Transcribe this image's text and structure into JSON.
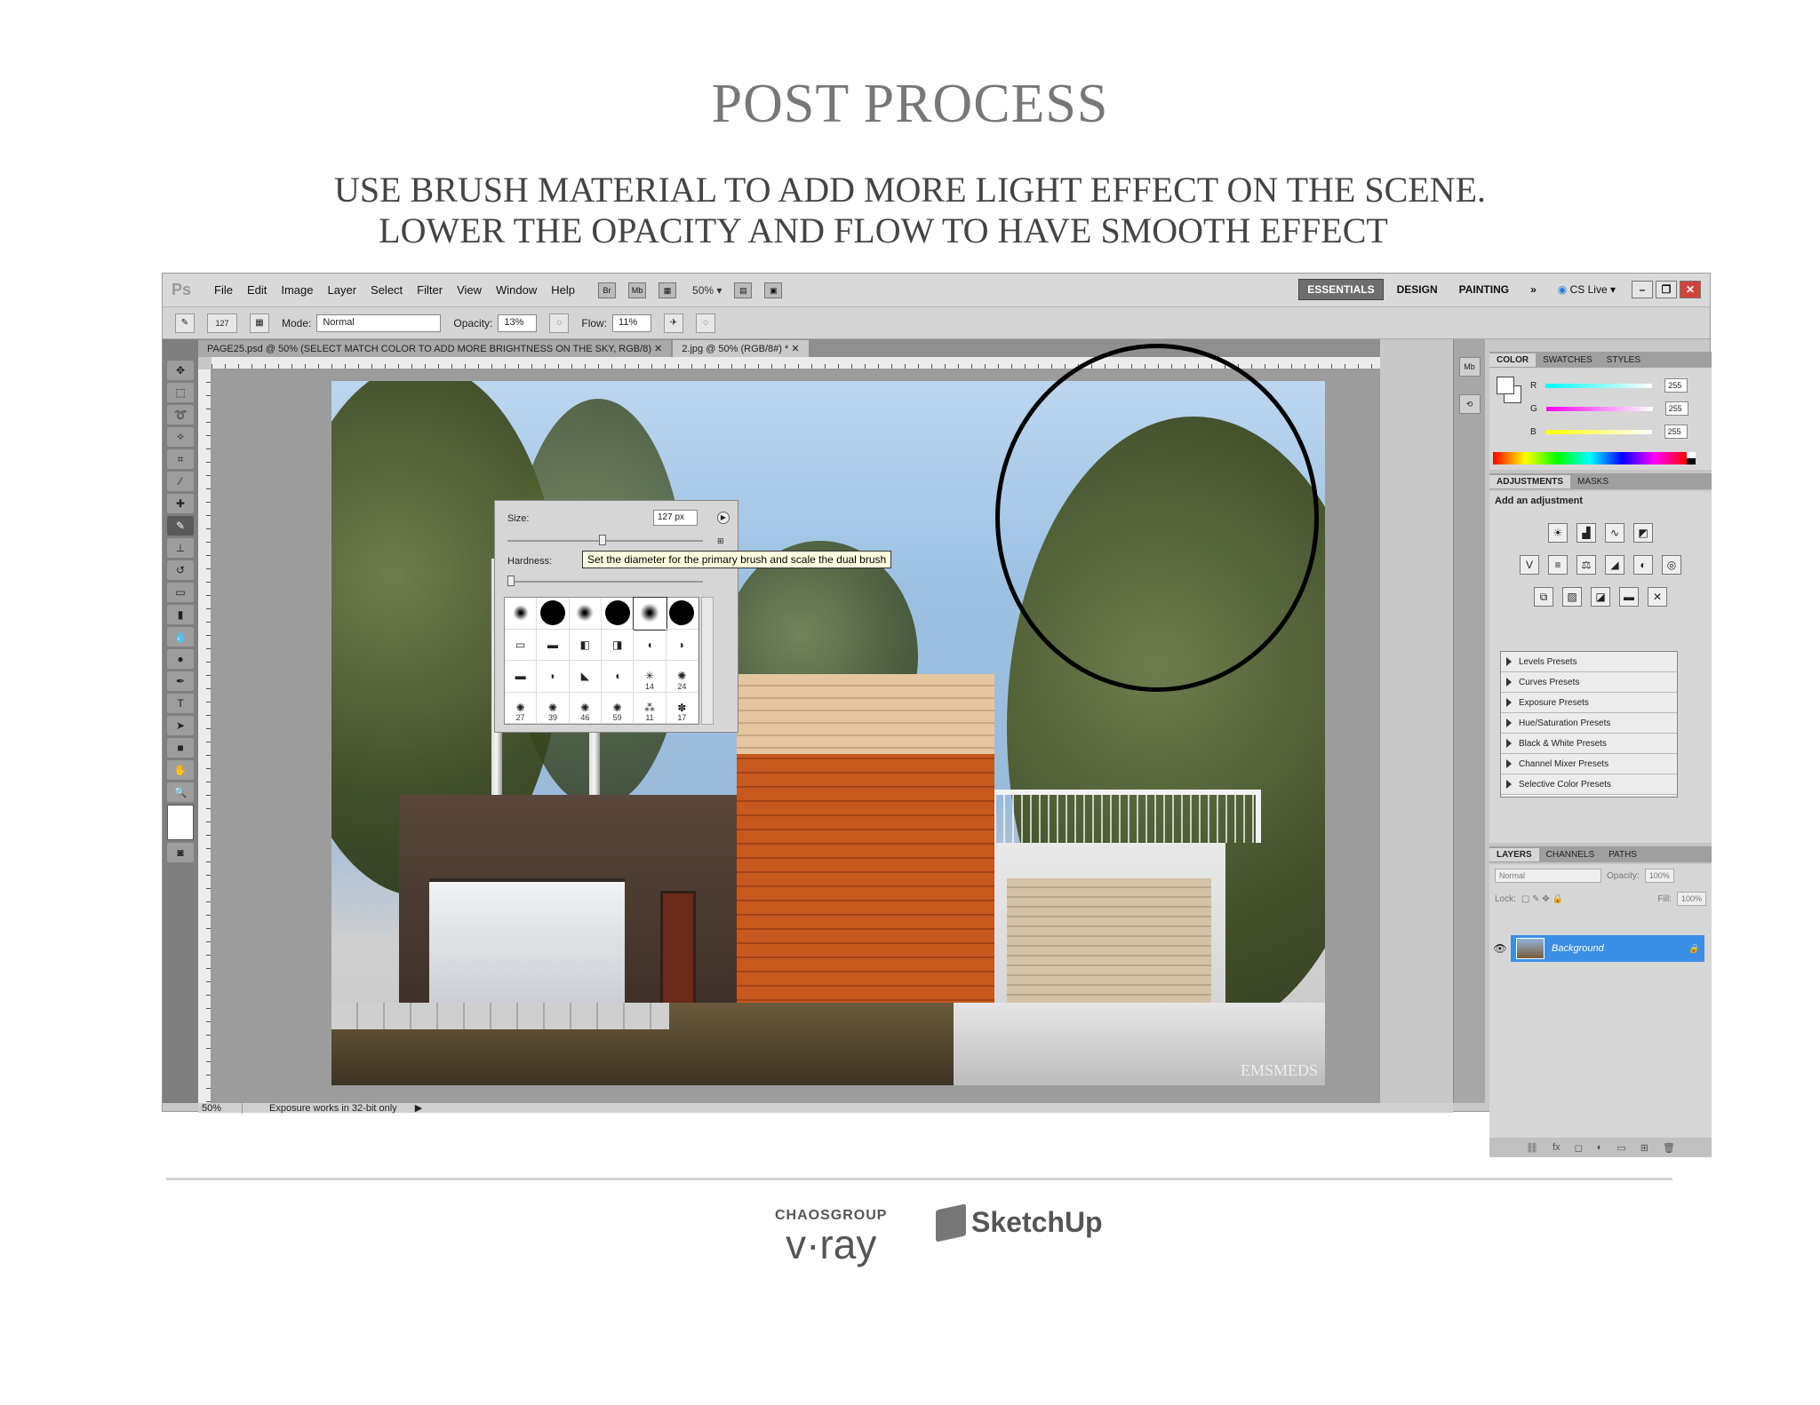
{
  "page": {
    "title": "POST PROCESS",
    "subtitle_line1": "USE BRUSH MATERIAL TO ADD MORE LIGHT EFFECT ON THE SCENE.",
    "subtitle_line2": "LOWER THE OPACITY AND FLOW TO HAVE SMOOTH EFFECT"
  },
  "app": {
    "logo": "Ps",
    "menu": [
      "File",
      "Edit",
      "Image",
      "Layer",
      "Select",
      "Filter",
      "View",
      "Window",
      "Help"
    ],
    "bridge_label": "Br",
    "minibridge_label": "Mb",
    "zoom": "50%",
    "workspaces": [
      "ESSENTIALS",
      "DESIGN",
      "PAINTING"
    ],
    "more": "»",
    "cslive": "CS Live"
  },
  "options": {
    "brush_size": "127",
    "mode_label": "Mode:",
    "mode_value": "Normal",
    "opacity_label": "Opacity:",
    "opacity_value": "13%",
    "flow_label": "Flow:",
    "flow_value": "11%"
  },
  "documents": [
    {
      "label": "PAGE25.psd @ 50% (SELECT MATCH COLOR TO ADD MORE BRIGHTNESS ON THE SKY, RGB/8)"
    },
    {
      "label": "2.jpg @ 50% (RGB/8#) *"
    }
  ],
  "ruler_numbers": [
    "5",
    "0",
    "5",
    "10",
    "15",
    "20",
    "25",
    "30",
    "35",
    "40",
    "45",
    "50",
    "55",
    "60",
    "65",
    "70",
    "75",
    "80"
  ],
  "brush_picker": {
    "size_label": "Size:",
    "size_value": "127 px",
    "size_fraction": 0.47,
    "hardness_label": "Hardness:",
    "hardness_fraction": 0.0,
    "tooltip": "Set the diameter for the primary brush and scale the dual brush",
    "numbers": [
      "14",
      "24",
      "27",
      "39",
      "46",
      "59",
      "11",
      "17"
    ]
  },
  "photo": {
    "watermark": "EMSMEDS"
  },
  "color_panel": {
    "tabs": [
      "COLOR",
      "SWATCHES",
      "STYLES"
    ],
    "channels": [
      {
        "name": "R",
        "value": "255",
        "color": "#e33"
      },
      {
        "name": "G",
        "value": "255",
        "color": "#d3d"
      },
      {
        "name": "B",
        "value": "255",
        "color": "#dd3"
      }
    ]
  },
  "adjustments": {
    "tabs": [
      "ADJUSTMENTS",
      "MASKS"
    ],
    "title": "Add an adjustment",
    "presets": [
      "Levels Presets",
      "Curves Presets",
      "Exposure Presets",
      "Hue/Saturation Presets",
      "Black & White Presets",
      "Channel Mixer Presets",
      "Selective Color Presets"
    ]
  },
  "layers": {
    "tabs": [
      "LAYERS",
      "CHANNELS",
      "PATHS"
    ],
    "blend_mode": "Normal",
    "opacity_label": "Opacity:",
    "opacity_value": "100%",
    "lock_label": "Lock:",
    "fill_label": "Fill:",
    "fill_value": "100%",
    "layer_name": "Background"
  },
  "status": {
    "zoom": "50%",
    "message": "Exposure works in 32-bit only"
  },
  "footer": {
    "vray_top": "CHAOSGROUP",
    "vray_main": "v·ray",
    "sketchup": "SketchUp"
  },
  "colors": {
    "accent_selected_layer": "#3a8ee6",
    "workspace_active": "#6e6e6e",
    "close_button": "#d0443a"
  }
}
